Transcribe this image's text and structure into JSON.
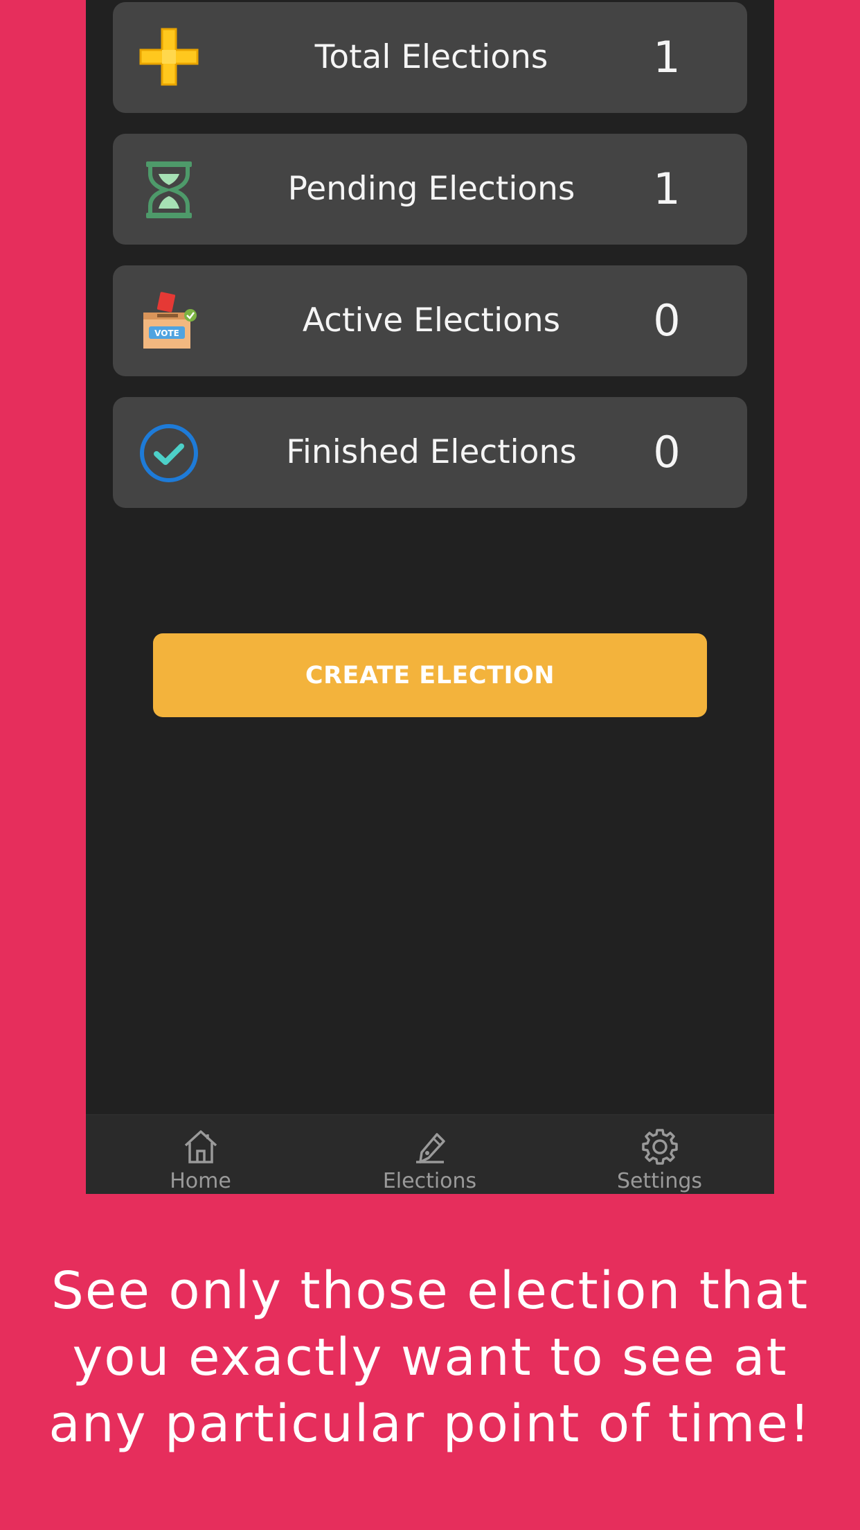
{
  "stats": [
    {
      "label": "Total Elections",
      "count": "1",
      "icon": "plus-icon"
    },
    {
      "label": "Pending Elections",
      "count": "1",
      "icon": "hourglass-icon"
    },
    {
      "label": "Active Elections",
      "count": "0",
      "icon": "ballot-box-icon"
    },
    {
      "label": "Finished Elections",
      "count": "0",
      "icon": "check-circle-icon"
    }
  ],
  "ballot_box_text": "VOTE",
  "create_button": {
    "label": "CREATE ELECTION"
  },
  "nav": [
    {
      "label": "Home",
      "icon": "home-icon"
    },
    {
      "label": "Elections",
      "icon": "pen-icon"
    },
    {
      "label": "Settings",
      "icon": "gear-icon"
    }
  ],
  "tagline": "See only those election that you exactly want to see at any particular point of time!",
  "colors": {
    "background": "#E62E5C",
    "screen": "#212121",
    "card": "#444444",
    "accent": "#F3B33C",
    "nav_text": "#9A9A9A"
  }
}
